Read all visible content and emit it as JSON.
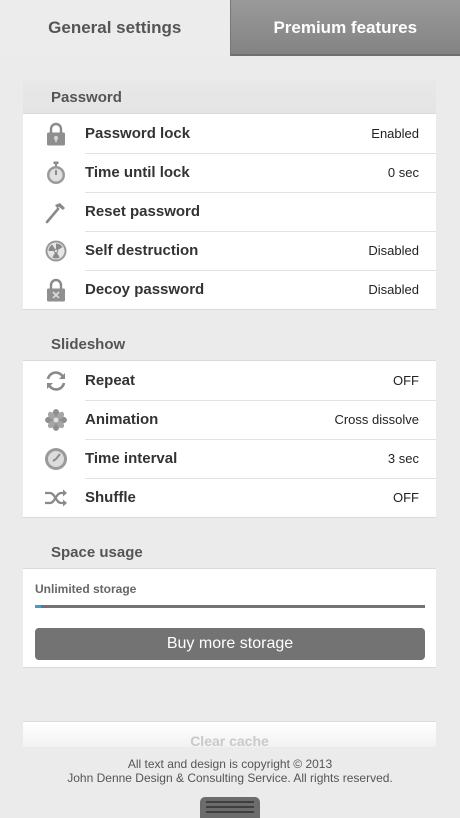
{
  "tabs": [
    {
      "label": "General settings",
      "active": true
    },
    {
      "label": "Premium features",
      "active": false
    }
  ],
  "password": {
    "title": "Password",
    "rows": [
      {
        "icon": "lock-icon",
        "label": "Password lock",
        "value": "Enabled"
      },
      {
        "icon": "stopwatch-icon",
        "label": "Time until lock",
        "value": "0 sec"
      },
      {
        "icon": "hammer-icon",
        "label": "Reset password",
        "value": ""
      },
      {
        "icon": "radiation-icon",
        "label": "Self destruction",
        "value": "Disabled"
      },
      {
        "icon": "decoy-lock-icon",
        "label": "Decoy password",
        "value": "Disabled"
      }
    ]
  },
  "slideshow": {
    "title": "Slideshow",
    "rows": [
      {
        "icon": "repeat-icon",
        "label": "Repeat",
        "value": "OFF"
      },
      {
        "icon": "flower-icon",
        "label": "Animation",
        "value": "Cross dissolve"
      },
      {
        "icon": "clock-icon",
        "label": "Time interval",
        "value": "3 sec"
      },
      {
        "icon": "shuffle-icon",
        "label": "Shuffle",
        "value": "OFF"
      }
    ]
  },
  "space": {
    "title": "Space usage",
    "storage_label": "Unlimited storage",
    "usage_fraction": 0.015,
    "buy_label": "Buy more storage"
  },
  "clear_cache_label": "Clear cache",
  "copyright": {
    "line1": "All text and design is copyright © 2013",
    "line2": "John Denne Design & Consulting Service. All rights reserved."
  },
  "colors": {
    "accent": "#3aa0d8",
    "button": "#737373",
    "background": "#ebebeb"
  }
}
